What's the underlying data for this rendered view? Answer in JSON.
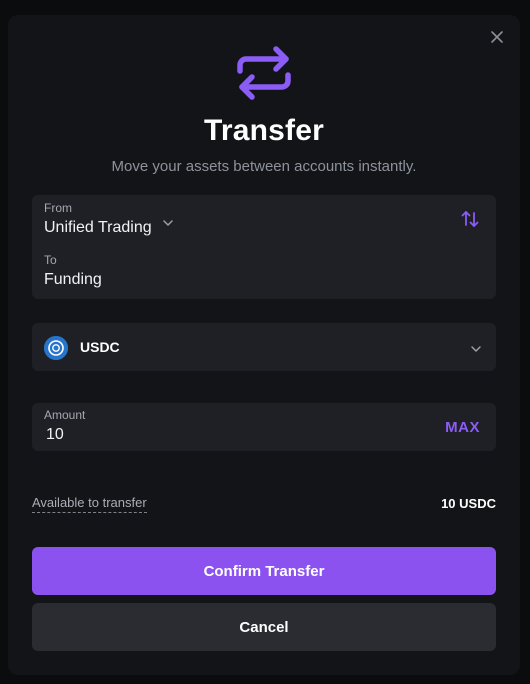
{
  "modal": {
    "title": "Transfer",
    "subtitle": "Move your assets between accounts instantly.",
    "close_icon": "close-icon",
    "hero_icon": "arrows-swap-icon"
  },
  "accounts": {
    "from_label": "From",
    "from_value": "Unified Trading",
    "to_label": "To",
    "to_value": "Funding",
    "swap_icon": "swap-vertical-icon"
  },
  "asset": {
    "name": "USDC",
    "icon": "usdc-coin-icon"
  },
  "amount": {
    "label": "Amount",
    "value": "10",
    "max_label": "MAX"
  },
  "available": {
    "label": "Available to transfer",
    "value": "10 USDC"
  },
  "buttons": {
    "confirm": "Confirm Transfer",
    "cancel": "Cancel"
  },
  "colors": {
    "accent": "#8b52f0",
    "background": "#131417",
    "card": "#1e2025",
    "usdc": "#2775ca"
  }
}
